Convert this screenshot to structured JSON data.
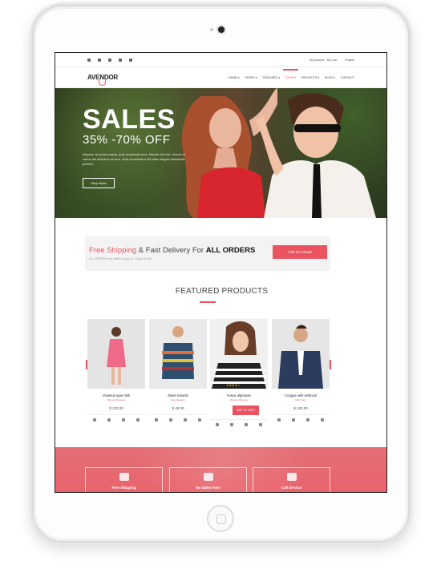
{
  "topbar": {
    "socials": [
      "facebook-icon",
      "twitter-icon",
      "pinterest-icon",
      "linkedin-icon",
      "dribbble-icon"
    ],
    "account": "My Account · My Cart",
    "language": "English"
  },
  "nav": {
    "logo": "AVENDOR",
    "items": [
      "HOME ▾",
      "PAGES ▾",
      "FEATURES ▾",
      "SHOP ▾",
      "PROJECTS ▾",
      "BLOG ▾",
      "CONTACT"
    ],
    "active": "SHOP ▾"
  },
  "hero": {
    "title": "SALES",
    "subtitle": "35% -70% OFF",
    "text": "Aliquam ac porta massa, quis accumsan eros. Mauris nisi nisl, viverra et varius dui interdum id eros. Duis consectetur elit vitae magna sollicitudin pretium.",
    "button": "Shop Now!"
  },
  "promo": {
    "part1": "Free Shipping",
    "part2": " & Fast Delivery For ",
    "part3": "ALL ORDERS",
    "small": "ALL ORDERS are deliver to you in 3 days or less",
    "button": "Visit Our Shop!"
  },
  "featured": {
    "title": "FEATURED PRODUCTS",
    "products": [
      {
        "name": "Vivamus eget nibh",
        "category": "Women Dresses",
        "price": "$ 120.00"
      },
      {
        "name": "Etiam lobortis",
        "category": "Men Sweater",
        "price": "$ 49.00"
      },
      {
        "name": "Fusce dignissim",
        "category": "Women Blouses",
        "price": "$ 35.00"
      },
      {
        "name": "Congue velit vehicula",
        "category": "Men Suits",
        "price": "$ 130.00"
      }
    ],
    "add_to_cart": "ADD TO CART"
  },
  "features_band": {
    "items": [
      "Free Shipping",
      "No Sales Fees",
      "Call Service"
    ]
  },
  "colors": {
    "accent": "#e95460"
  }
}
